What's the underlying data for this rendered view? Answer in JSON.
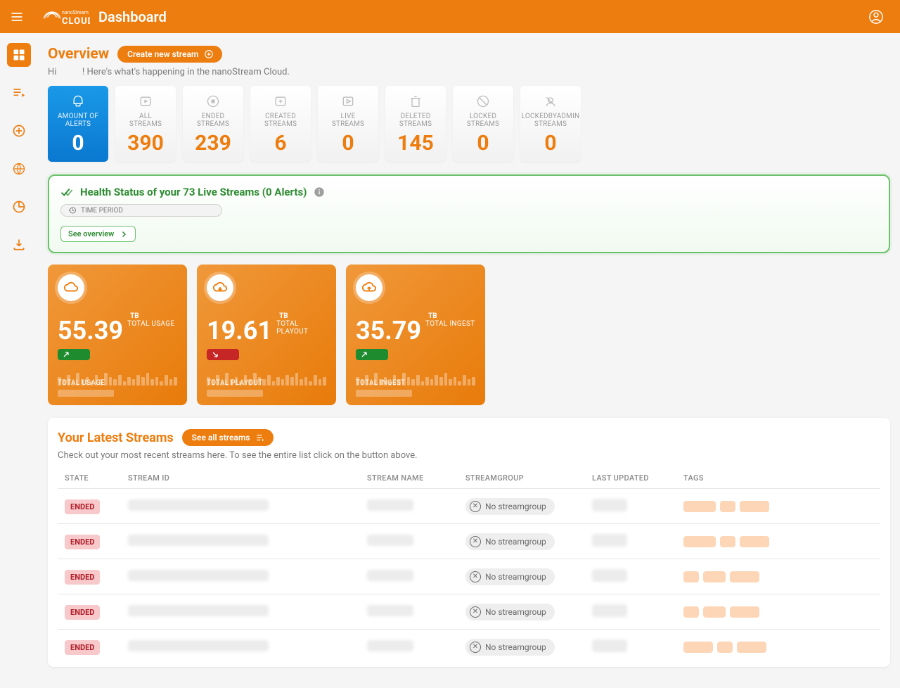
{
  "app": {
    "title": "Dashboard",
    "brand_top": "nanoStream",
    "brand_bottom": "CLOUD"
  },
  "overview": {
    "heading": "Overview",
    "create_btn": "Create new stream",
    "greeting_prefix": "Hi",
    "greeting_suffix": "! Here's what's happening in the nanoStream Cloud."
  },
  "stats": [
    {
      "label": "AMOUNT OF\nALERTS",
      "value": "0",
      "blue": true,
      "icon": "alert"
    },
    {
      "label": "ALL\nSTREAMS",
      "value": "390",
      "icon": "play"
    },
    {
      "label": "ENDED\nSTREAMS",
      "value": "239",
      "icon": "stop"
    },
    {
      "label": "CREATED\nSTREAMS",
      "value": "6",
      "icon": "create"
    },
    {
      "label": "LIVE\nSTREAMS",
      "value": "0",
      "icon": "live"
    },
    {
      "label": "DELETED\nSTREAMS",
      "value": "145",
      "icon": "delete"
    },
    {
      "label": "LOCKED\nSTREAMS",
      "value": "0",
      "icon": "lock"
    },
    {
      "label": "LOCKEDBYADMIN\nSTREAMS",
      "value": "0",
      "icon": "lockadmin"
    }
  ],
  "health": {
    "title": "Health Status of your 73 Live Streams (0 Alerts)",
    "time_period_label": "TIME PERIOD",
    "see_overview": "See overview"
  },
  "usage": [
    {
      "value": "55.39",
      "unit": "TB",
      "sub": "TOTAL USAGE",
      "trend": "up",
      "footer": "TOTAL USAGE",
      "icon": "cloud"
    },
    {
      "value": "19.61",
      "unit": "TB",
      "sub": "TOTAL PLAYOUT",
      "trend": "down",
      "footer": "TOTAL PLAYOUT",
      "icon": "cloud-down"
    },
    {
      "value": "35.79",
      "unit": "TB",
      "sub": "TOTAL INGEST",
      "trend": "up",
      "footer": "TOTAL INGEST",
      "icon": "cloud-up"
    }
  ],
  "latest_streams": {
    "heading": "Your Latest Streams",
    "see_all_btn": "See all streams",
    "sub": "Check out your most recent streams here. To see the entire list click on the button above.",
    "columns": [
      "STATE",
      "STREAM ID",
      "STREAM NAME",
      "STREAMGROUP",
      "LAST UPDATED",
      "TAGS"
    ],
    "rows": [
      {
        "state": "ENDED",
        "streamgroup": "No streamgroup",
        "tag_widths": [
          46,
          22,
          42
        ]
      },
      {
        "state": "ENDED",
        "streamgroup": "No streamgroup",
        "tag_widths": [
          46,
          22,
          42
        ]
      },
      {
        "state": "ENDED",
        "streamgroup": "No streamgroup",
        "tag_widths": [
          22,
          32,
          42
        ]
      },
      {
        "state": "ENDED",
        "streamgroup": "No streamgroup",
        "tag_widths": [
          22,
          32,
          42
        ]
      },
      {
        "state": "ENDED",
        "streamgroup": "No streamgroup",
        "tag_widths": [
          42,
          22,
          42
        ]
      }
    ]
  }
}
